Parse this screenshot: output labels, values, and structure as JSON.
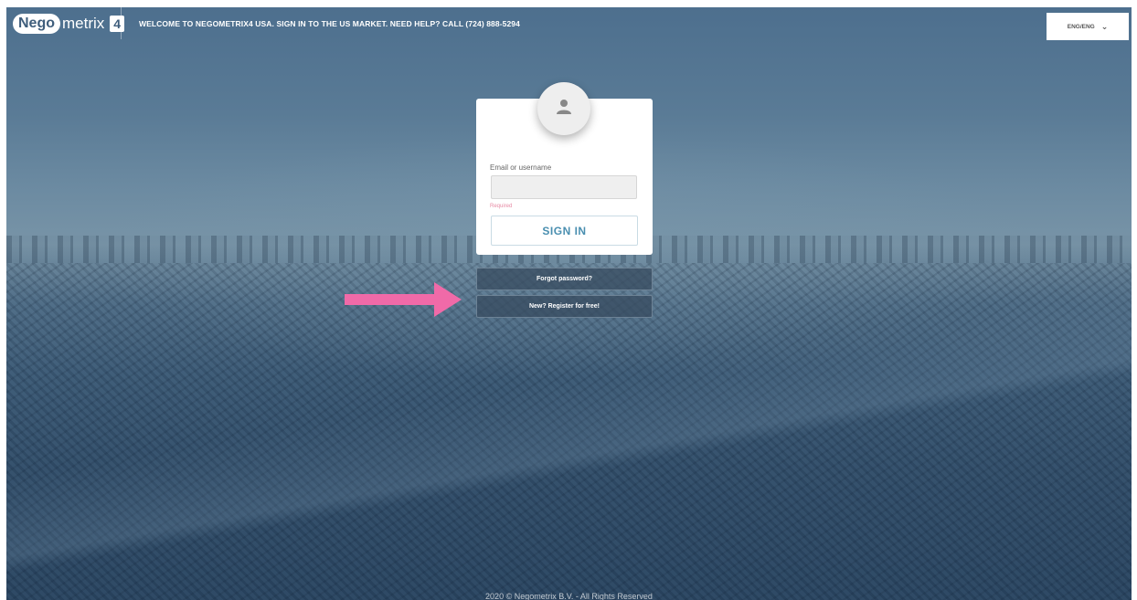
{
  "header": {
    "logo_nego": "Nego",
    "logo_metrix": "metrix",
    "logo_number": "4",
    "welcome_text": "WELCOME TO NEGOMETRIX4 USA. SIGN IN TO THE US MARKET. NEED HELP? CALL (724) 888-5294",
    "language": "ENG/ENG",
    "language_icon": "chevron-down-icon"
  },
  "login": {
    "avatar_icon": "user-icon",
    "email_label": "Email or username",
    "email_value": "",
    "required_text": "Required",
    "signin_label": "SIGN IN"
  },
  "links": {
    "forgot_password": "Forgot password?",
    "register": "New? Register for free!"
  },
  "annotation": {
    "arrow_icon": "arrow-right-icon",
    "arrow_color": "#f06aa8"
  },
  "footer": {
    "copyright": "2020 © Negometrix B.V. - All Rights Reserved"
  }
}
